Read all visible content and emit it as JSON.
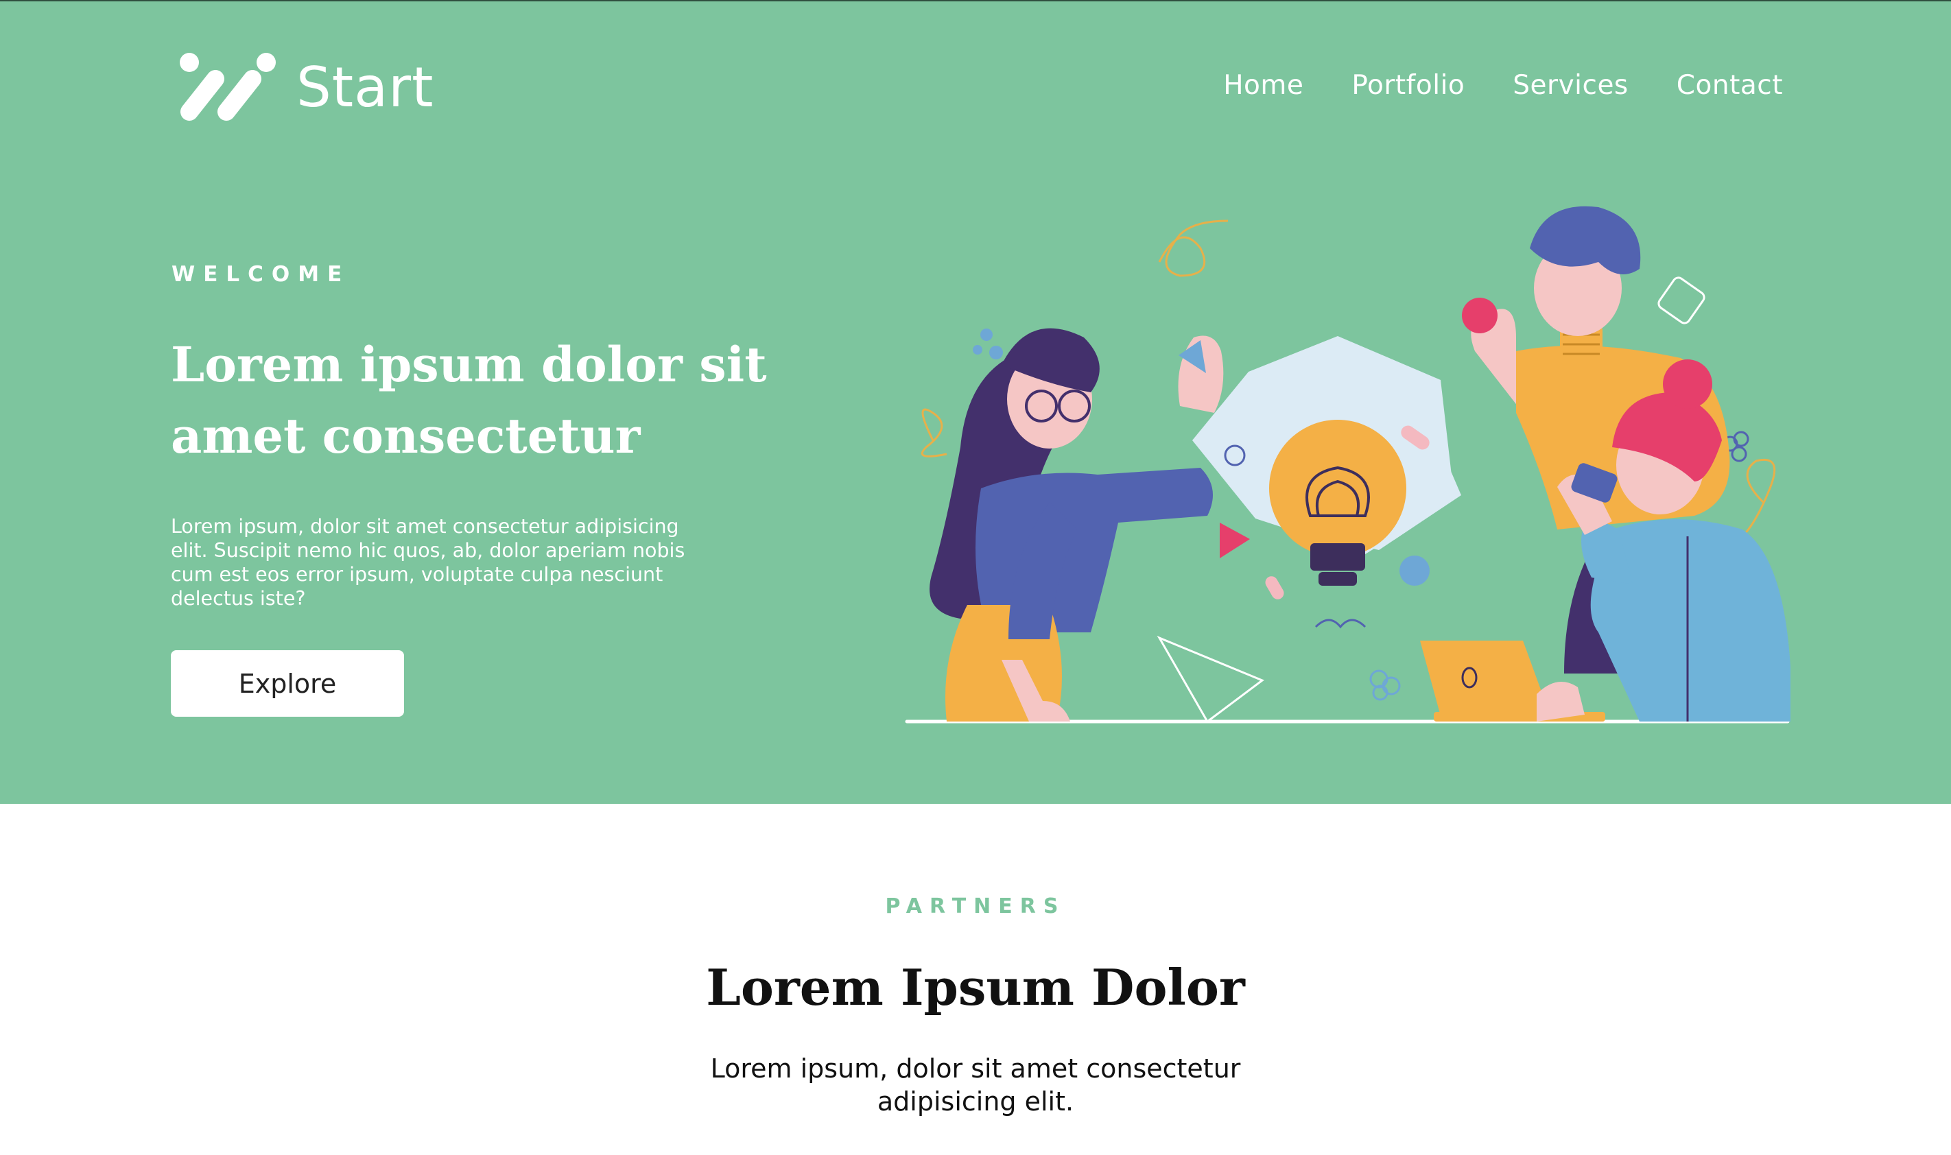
{
  "colors": {
    "hero_bg": "#7dc59e",
    "accent": "#7dc59e",
    "text_dark": "#111111",
    "white": "#ffffff"
  },
  "header": {
    "logo_text": "Start",
    "logo_icon": "brand-slashes-icon",
    "nav": [
      {
        "label": "Home"
      },
      {
        "label": "Portfolio"
      },
      {
        "label": "Services"
      },
      {
        "label": "Contact"
      }
    ]
  },
  "hero": {
    "eyebrow": "WELCOME",
    "title": "Lorem ipsum dolor sit amet consectetur",
    "description": "Lorem ipsum, dolor sit amet consectetur adipisicing elit. Suscipit nemo hic quos, ab, dolor aperiam nobis cum est eos error ipsum, voluptate culpa nesciunt delectus iste?",
    "button_label": "Explore",
    "illustration": "team-brainstorm-lightbulb-illustration"
  },
  "partners": {
    "eyebrow": "PARTNERS",
    "title": "Lorem Ipsum Dolor",
    "description": "Lorem ipsum, dolor sit amet consectetur adipisicing elit."
  }
}
